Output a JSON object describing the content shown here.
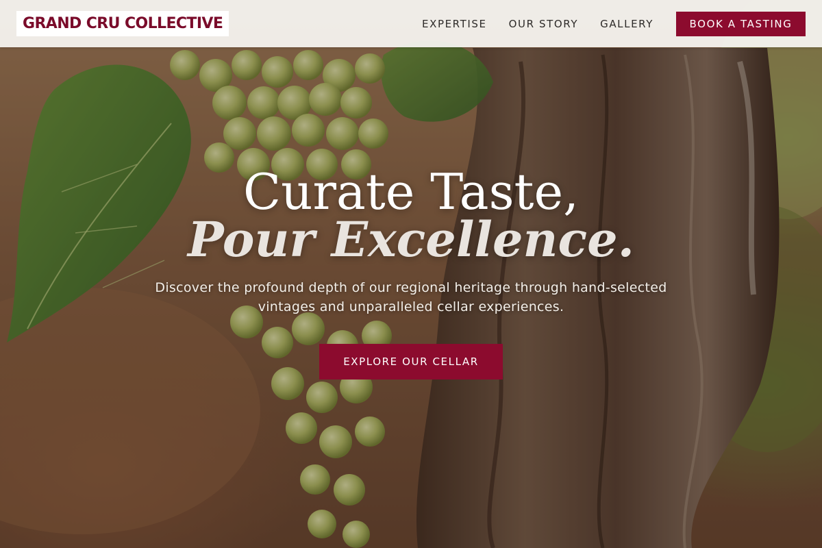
{
  "brand": {
    "logo_text": "GRAND CRU COLLECTIVE",
    "primary_color": "#8c0b2e",
    "logo_color": "#7a0b2a"
  },
  "nav": {
    "links": [
      {
        "label": "EXPERTISE"
      },
      {
        "label": "OUR STORY"
      },
      {
        "label": "GALLERY"
      }
    ],
    "cta_label": "BOOK A TASTING"
  },
  "hero": {
    "headline_line1": "Curate Taste,",
    "headline_line2": "Pour Excellence.",
    "subtext": "Discover the profound depth of our regional heritage through hand-selected vintages and unparalleled cellar experiences.",
    "cta_label": "EXPLORE OUR CELLAR",
    "background_image": "vineyard-grapes-and-old-vine-trunk"
  }
}
